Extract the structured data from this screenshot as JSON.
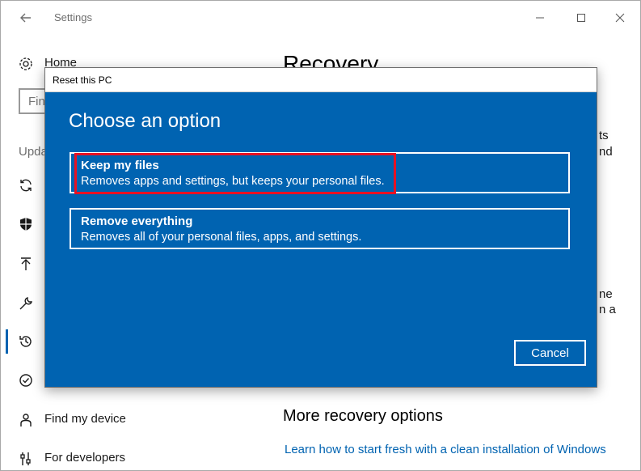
{
  "window": {
    "title": "Settings"
  },
  "sidebar": {
    "home_label": "Home",
    "search_placeholder": "Find",
    "section_header": "Upda",
    "items": [
      {
        "label": "",
        "icon": "sync-icon"
      },
      {
        "label": "",
        "icon": "shield-icon"
      },
      {
        "label": "",
        "icon": "upload-icon"
      },
      {
        "label": "",
        "icon": "wrench-icon"
      },
      {
        "label": "",
        "icon": "history-icon",
        "selected": true
      },
      {
        "label": "",
        "icon": "check-circle-icon"
      },
      {
        "label": "Find my device",
        "icon": "person-icon"
      },
      {
        "label": "For developers",
        "icon": "sliders-icon"
      }
    ]
  },
  "main": {
    "title": "Recovery",
    "peek_text_1": "ts",
    "peek_text_2": "nd",
    "peek_text_3": "ne",
    "peek_text_4": "n a",
    "more_options_title": "More recovery options",
    "link_text": "Learn how to start fresh with a clean installation of Windows"
  },
  "dialog": {
    "window_title": "Reset this PC",
    "heading": "Choose an option",
    "options": [
      {
        "title": "Keep my files",
        "description": "Removes apps and settings, but keeps your personal files.",
        "highlighted": true
      },
      {
        "title": "Remove everything",
        "description": "Removes all of your personal files, apps, and settings."
      }
    ],
    "cancel_label": "Cancel"
  },
  "colors": {
    "accent": "#0063b1",
    "highlight_border": "#e81123",
    "dialog_text": "#ffffff"
  }
}
